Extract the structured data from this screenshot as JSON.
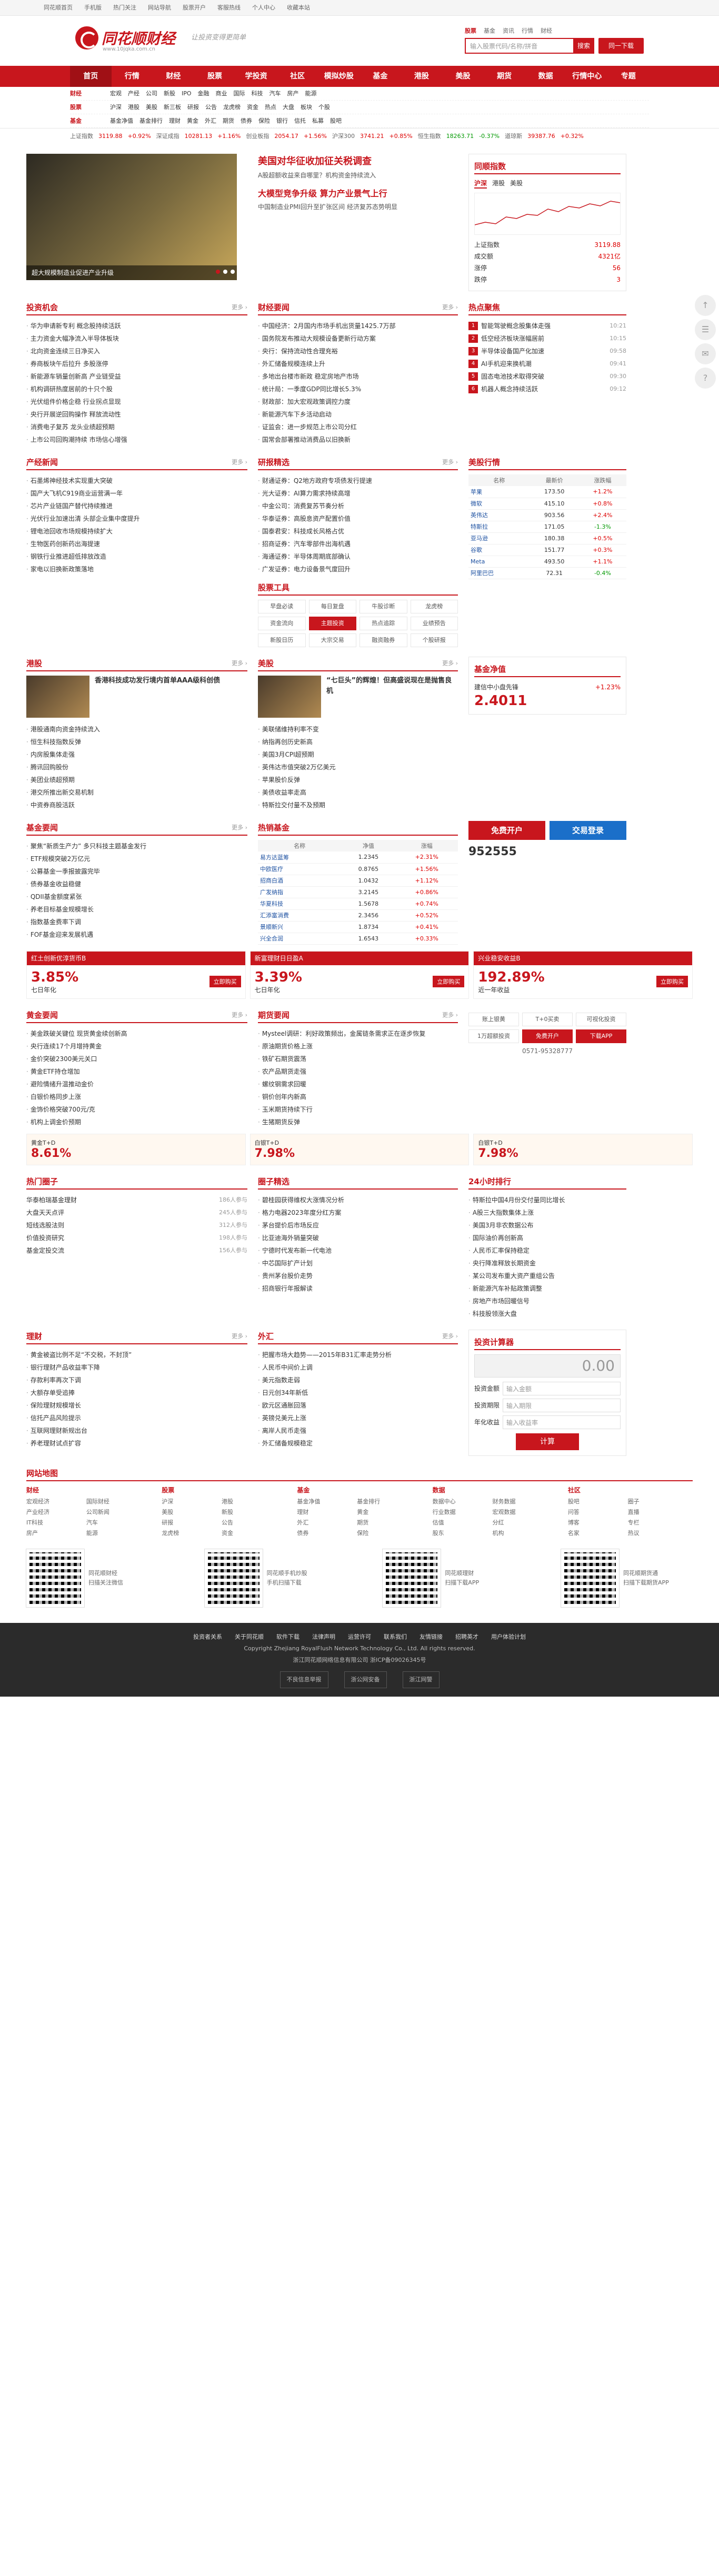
{
  "topbar": {
    "items": [
      "同花顺首页",
      "手机版",
      "热门关注",
      "网站导航",
      "股票开户",
      "客服热线",
      "个人中心",
      "收藏本站"
    ]
  },
  "header": {
    "logo_name": "同花顺财经",
    "logo_url": "www.10jqka.com.cn",
    "slogan": "让投资变得更简单",
    "search_tabs": [
      "股票",
      "基金",
      "资讯",
      "行情",
      "财经"
    ],
    "search_placeholder": "输入股票代码/名称/拼音",
    "search_btn": "搜索",
    "app_btn": "同一下载"
  },
  "nav": [
    "首页",
    "行情",
    "财经",
    "股票",
    "学投资",
    "社区",
    "模拟炒股",
    "基金",
    "港股",
    "美股",
    "期货",
    "数据",
    "行情中心",
    "专题"
  ],
  "subnav": [
    {
      "label": "财经",
      "items": [
        "宏观",
        "产经",
        "公司",
        "新股",
        "IPO",
        "金融",
        "商业",
        "国际",
        "科技",
        "汽车",
        "房产",
        "能源"
      ]
    },
    {
      "label": "股票",
      "items": [
        "沪深",
        "港股",
        "美股",
        "新三板",
        "研报",
        "公告",
        "龙虎榜",
        "资金",
        "热点",
        "大盘",
        "板块",
        "个股"
      ]
    },
    {
      "label": "基金",
      "items": [
        "基金净值",
        "基金排行",
        "理财",
        "黄金",
        "外汇",
        "期货",
        "债券",
        "保险",
        "银行",
        "信托",
        "私募",
        "股吧"
      ]
    }
  ],
  "indices": [
    {
      "name": "上证指数",
      "val": "3119.88",
      "chg": "+0.92%",
      "up": true
    },
    {
      "name": "深证成指",
      "val": "10281.13",
      "chg": "+1.16%",
      "up": true
    },
    {
      "name": "创业板指",
      "val": "2054.17",
      "chg": "+1.56%",
      "up": true
    },
    {
      "name": "沪深300",
      "val": "3741.21",
      "chg": "+0.85%",
      "up": true
    },
    {
      "name": "恒生指数",
      "val": "18263.71",
      "chg": "-0.37%",
      "up": false
    },
    {
      "name": "道琼斯",
      "val": "39387.76",
      "chg": "+0.32%",
      "up": true
    }
  ],
  "focus": {
    "cap": "超大规模制造业促进产业升级",
    "headline1": "美国对华征收加征关税调查",
    "sum1": "A股超额收益来自哪里？机构资金持续流入",
    "headline2": "大模型竞争升级 算力产业景气上行",
    "sum2": "中国制造业PMI回升至扩张区间 经济复苏态势明显"
  },
  "market": {
    "title": "同顺指数",
    "tabs": [
      "沪深",
      "港股",
      "美股"
    ],
    "kv": [
      [
        "上证指数",
        "3119.88"
      ],
      [
        "成交额",
        "4321亿"
      ],
      [
        "涨停",
        "56"
      ],
      [
        "跌停",
        "3"
      ]
    ]
  },
  "invest": {
    "title": "投资机会",
    "items": [
      "华为申请新专利 概念股持续活跃",
      "主力资金大幅净流入半导体板块",
      "北向资金连续三日净买入",
      "券商板块午后拉升 多股涨停",
      "新能源车销量创新高 产业链受益",
      "机构调研热度居前的十只个股",
      "光伏组件价格企稳 行业拐点显现",
      "央行开展逆回购操作 释放流动性",
      "消费电子复苏 龙头业绩超预期",
      "上市公司回购潮持续 市场信心增强"
    ]
  },
  "finance": {
    "title": "财经要闻",
    "items": [
      "中国经济：2月国内市场手机出货量1425.7万部",
      "国务院发布推动大规模设备更新行动方案",
      "央行：保持流动性合理充裕",
      "外汇储备规模连续上升",
      "多地出台楼市新政 稳定房地产市场",
      "统计局：一季度GDP同比增长5.3%",
      "财政部：加大宏观政策调控力度",
      "新能源汽车下乡活动启动",
      "证监会：进一步规范上市公司分红",
      "国常会部署推动消费品以旧换新"
    ]
  },
  "hot": {
    "title": "热点聚焦",
    "items": [
      [
        "智能驾驶概念股集体走强",
        "10:21"
      ],
      [
        "低空经济板块涨幅居前",
        "10:15"
      ],
      [
        "半导体设备国产化加速",
        "09:58"
      ],
      [
        "AI手机迎来换机潮",
        "09:41"
      ],
      [
        "固态电池技术取得突破",
        "09:30"
      ],
      [
        "机器人概念持续活跃",
        "09:12"
      ]
    ]
  },
  "industry": {
    "title": "产经新闻",
    "items": [
      "石墨烯神经技术实现重大突破",
      "国产大飞机C919商业运营满一年",
      "芯片产业链国产替代持续推进",
      "光伏行业加速出清 头部企业集中度提升",
      "锂电池回收市场规模持续扩大",
      "生物医药创新药出海提速",
      "钢铁行业推进超低排放改造",
      "家电以旧换新政策落地"
    ]
  },
  "research": {
    "title": "研报精选",
    "items": [
      "财通证券：Q2地方政府专项债发行提速",
      "光大证券：AI算力需求持续高增",
      "中金公司：消费复苏节奏分析",
      "华泰证券：高股息资产配置价值",
      "国泰君安：科技成长风格占优",
      "招商证券：汽车零部件出海机遇",
      "海通证券：半导体周期底部确认",
      "广发证券：电力设备景气度回升"
    ]
  },
  "stock_tools": {
    "title": "股票工具",
    "items": [
      "早盘必读",
      "每日复盘",
      "牛股诊断",
      "龙虎榜",
      "资金流向",
      "主题投资",
      "热点追踪",
      "业绩预告",
      "新股日历",
      "大宗交易",
      "融资融券",
      "个股研报"
    ]
  },
  "mmarket": {
    "title": "美股行情",
    "stocks": [
      [
        "苹果",
        "173.50",
        "+1.2%"
      ],
      [
        "微软",
        "415.10",
        "+0.8%"
      ],
      [
        "英伟达",
        "903.56",
        "+2.4%"
      ],
      [
        "特斯拉",
        "171.05",
        "-1.3%"
      ],
      [
        "亚马逊",
        "180.38",
        "+0.5%"
      ],
      [
        "谷歌",
        "151.77",
        "+0.3%"
      ],
      [
        "Meta",
        "493.50",
        "+1.1%"
      ],
      [
        "阿里巴巴",
        "72.31",
        "-0.4%"
      ]
    ]
  },
  "hk": {
    "title": "港股",
    "items": [
      "香港科技成功发行境内首单AAA级科创债",
      "港股通南向资金持续流入",
      "恒生科技指数反弹",
      "内房股集体走强",
      "腾讯回购股份",
      "美团业绩超预期",
      "港交所推出新交易机制",
      "中资券商股活跃"
    ]
  },
  "us": {
    "title": "美股",
    "items": [
      "“七巨头”的辉煌！但高盛说现在是抛售良机",
      "美联储维持利率不变",
      "纳指再创历史新高",
      "美国3月CPI超预期",
      "英伟达市值突破2万亿美元",
      "苹果股价反弹",
      "美债收益率走高",
      "特斯拉交付量不及预期"
    ]
  },
  "fund": {
    "title": "基金要闻",
    "items": [
      "聚焦“新质生产力” 多只科技主题基金发行",
      "ETF规模突破2万亿元",
      "公募基金一季报披露完毕",
      "债券基金收益稳健",
      "QDII基金额度紧张",
      "养老目标基金规模增长",
      "指数基金费率下调",
      "FOF基金迎来发展机遇"
    ]
  },
  "hotfund": {
    "title": "热销基金",
    "rows": [
      [
        "易方达蓝筹",
        "1.2345",
        "+2.31%"
      ],
      [
        "中欧医疗",
        "0.8765",
        "+1.56%"
      ],
      [
        "招商白酒",
        "1.0432",
        "+1.12%"
      ],
      [
        "广发纳指",
        "3.2145",
        "+0.86%"
      ],
      [
        "华夏科技",
        "1.5678",
        "+0.74%"
      ],
      [
        "汇添富消费",
        "2.3456",
        "+0.52%"
      ],
      [
        "景顺新兴",
        "1.8734",
        "+0.41%"
      ],
      [
        "兴全合润",
        "1.6543",
        "+0.33%"
      ]
    ]
  },
  "fund_boxes": [
    {
      "title": "红土创新优淳货币B",
      "rate": "3.85%",
      "label": "七日年化",
      "btn": "立即购买"
    },
    {
      "title": "新富理财日日盈A",
      "rate": "3.39%",
      "label": "七日年化",
      "btn": "立即购买"
    },
    {
      "title": "兴业稳安收益B",
      "rate": "192.89%",
      "label": "近一年收益",
      "btn": "立即购买"
    }
  ],
  "fundcard": {
    "title": "基金净值",
    "name": "建信中小盘先锋",
    "nav": "2.4011",
    "chg": "+1.23%"
  },
  "actions": {
    "open": "免费开户",
    "login": "交易登录",
    "code": "952555"
  },
  "gold_news": {
    "title": "黄金要闻",
    "items": [
      "美金跌破关键位 现货黄金续创新高",
      "央行连续17个月增持黄金",
      "金价突破2300美元关口",
      "黄金ETF持仓增加",
      "避险情绪升温推动金价",
      "白银价格同步上涨",
      "金饰价格突破700元/克",
      "机构上调金价预期"
    ]
  },
  "futures": {
    "title": "期货要闻",
    "items": [
      "Mysteel调研：利好政策频出，金属链条需求正在逐步恢复",
      "原油期货价格上涨",
      "铁矿石期货震荡",
      "农产品期货走强",
      "螺纹钢需求回暖",
      "铜价创年内新高",
      "玉米期货持续下行",
      "生猪期货反弹"
    ]
  },
  "gold": [
    {
      "label": "黄金T+D",
      "pct": "8.61%"
    },
    {
      "label": "白银T+D",
      "pct": "7.98%"
    },
    {
      "label": "白银T+D",
      "pct": "7.98%"
    }
  ],
  "services": {
    "items": [
      "账上银黄",
      "T+0买卖",
      "可视化投资",
      "1万超额投资",
      "免费开户",
      "下载APP"
    ],
    "phone": "0571-95328777"
  },
  "hot24": {
    "title": "24小时排行",
    "items": [
      "特斯拉中国4月份交付量同比增长",
      "A股三大指数集体上涨",
      "美国3月非农数据公布",
      "国际油价再创新高",
      "人民币汇率保持稳定",
      "央行降准释放长期资金",
      "某公司发布重大资产重组公告",
      "新能源汽车补贴政策调整",
      "房地产市场回暖信号",
      "科技股领涨大盘"
    ]
  },
  "people": {
    "title": "热门圈子",
    "items": [
      [
        "华泰柏瑞基金理财",
        "186人参与"
      ],
      [
        "大盘天天点评",
        "245人参与"
      ],
      [
        "短线选股法则",
        "312人参与"
      ],
      [
        "价值投资研究",
        "198人参与"
      ],
      [
        "基金定投交流",
        "156人参与"
      ]
    ]
  },
  "circle": {
    "title": "圈子精选",
    "items": [
      "碧桂园获得维权大涨情况分析",
      "格力电器2023年度分红方案",
      "茅台提价后市场反应",
      "比亚迪海外销量突破",
      "宁德时代发布新一代电池",
      "中芯国际扩产计划",
      "贵州茅台股价走势",
      "招商银行年报解读"
    ]
  },
  "calc": {
    "title": "投资计算器",
    "disp": "0.00",
    "fields": [
      [
        "投资金额",
        "输入金额"
      ],
      [
        "投资期限",
        "输入期限"
      ],
      [
        "年化收益",
        "输入收益率"
      ]
    ],
    "btn": "计算"
  },
  "finance2": {
    "title": "理财",
    "items": [
      "黄金被盗比例不足“不交税，不封顶”",
      "银行理财产品收益率下降",
      "存款利率再次下调",
      "大额存单受追捧",
      "保险理财规模增长",
      "信托产品风险提示",
      "互联网理财新规出台",
      "养老理财试点扩容"
    ]
  },
  "forex": {
    "title": "外汇",
    "items": [
      "把握市场大趋势——2015年B31汇率走势分析",
      "人民币中间价上调",
      "美元指数走弱",
      "日元创34年新低",
      "欧元区通胀回落",
      "英镑兑美元上涨",
      "离岸人民币走强",
      "外汇储备规模稳定"
    ]
  },
  "sitemap": {
    "title": "网站地图",
    "cols": [
      {
        "h": "财经",
        "items": [
          "宏观经济",
          "国际财经",
          "产业经济",
          "公司新闻",
          "IT科技",
          "汽车",
          "房产",
          "能源"
        ]
      },
      {
        "h": "股票",
        "items": [
          "沪深",
          "港股",
          "美股",
          "新股",
          "研报",
          "公告",
          "龙虎榜",
          "资金"
        ]
      },
      {
        "h": "基金",
        "items": [
          "基金净值",
          "基金排行",
          "理财",
          "黄金",
          "外汇",
          "期货",
          "债券",
          "保险"
        ]
      },
      {
        "h": "数据",
        "items": [
          "数据中心",
          "财务数据",
          "行业数据",
          "宏观数据",
          "估值",
          "分红",
          "股东",
          "机构"
        ]
      },
      {
        "h": "社区",
        "items": [
          "股吧",
          "圈子",
          "问答",
          "直播",
          "博客",
          "专栏",
          "名家",
          "热议"
        ]
      }
    ]
  },
  "qrs": [
    {
      "t1": "同花顺财经",
      "t2": "扫描关注微信"
    },
    {
      "t1": "同花顺手机炒股",
      "t2": "手机扫描下载"
    },
    {
      "t1": "同花顺理财",
      "t2": "扫描下载APP"
    },
    {
      "t1": "同花顺期货通",
      "t2": "扫描下载期货APP"
    }
  ],
  "footer": {
    "links": [
      "投资者关系",
      "关于同花顺",
      "软件下载",
      "法律声明",
      "运营许可",
      "联系我们",
      "友情链接",
      "招聘英才",
      "用户体验计划"
    ],
    "copy": "Copyright Zhejiang RoyalFlush Network Technology Co., Ltd. All rights reserved.",
    "icp": "浙江同花顺网络信息有限公司 浙ICP备09026345号",
    "badges": [
      "不良信息举报",
      "浙公网安备",
      "浙江网警"
    ]
  },
  "side": {
    "items": [
      "↑",
      "☰",
      "✉",
      "?"
    ]
  }
}
